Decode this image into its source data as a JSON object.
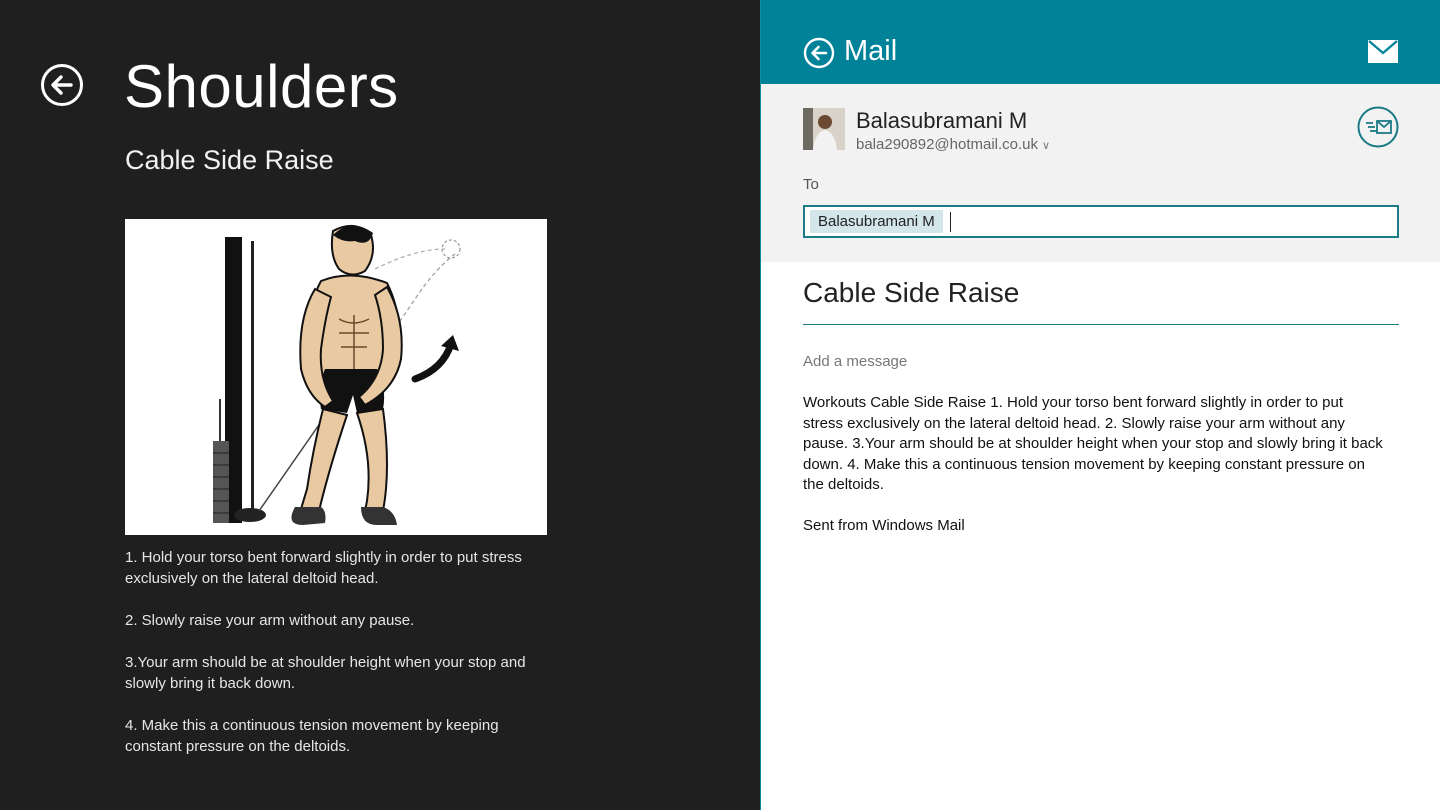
{
  "exercise_page": {
    "title": "Shoulders",
    "subtitle": "Cable Side Raise",
    "steps": [
      "1. Hold your torso bent forward slightly in order to put stress exclusively on the lateral deltoid head.",
      "2. Slowly raise your arm without any pause.",
      "3.Your arm should be at shoulder height when your stop and slowly bring it back down.",
      "4. Make this a continuous tension movement by keeping constant pressure on the deltoids."
    ]
  },
  "mail": {
    "title": "Mail",
    "from": {
      "name": "Balasubramani M",
      "email": "bala290892@hotmail.co.uk"
    },
    "to_label": "To",
    "recipients": [
      "Balasubramani M"
    ],
    "subject": "Cable Side Raise",
    "add_message_placeholder": "Add a message",
    "body": "Workouts Cable Side Raise 1. Hold your torso bent forward slightly in order to put stress exclusively on the lateral deltoid head. 2. Slowly raise your arm without any pause. 3.Your arm should be at shoulder height when your stop and slowly bring it back down. 4. Make this a continuous tension movement by keeping constant pressure on the deltoids.",
    "signature": "Sent from Windows Mail"
  },
  "colors": {
    "left_background": "#1f1f1f",
    "mail_accent": "#008299",
    "from_section_background": "#f2f2f2",
    "recipient_chip": "#d3e6ea"
  },
  "icons": {
    "left_back": "back-arrow-circle-icon",
    "mail_back": "back-arrow-circle-icon",
    "mail": "envelope-icon",
    "send": "send-mail-icon"
  }
}
